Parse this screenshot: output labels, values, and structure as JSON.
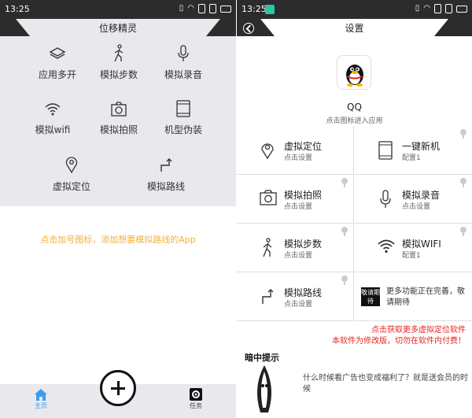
{
  "left": {
    "status_time": "13:25",
    "title": "位移精灵",
    "items": [
      {
        "label": "应用多开",
        "icon": "layers-icon"
      },
      {
        "label": "模拟步数",
        "icon": "walking-person-icon"
      },
      {
        "label": "模拟录音",
        "icon": "microphone-icon"
      },
      {
        "label": "模拟wifi",
        "icon": "wifi-icon"
      },
      {
        "label": "模拟拍照",
        "icon": "camera-icon"
      },
      {
        "label": "机型伪装",
        "icon": "phone-device-icon"
      },
      {
        "label": "虚拟定位",
        "icon": "location-pin-icon"
      },
      {
        "label": "模拟路线",
        "icon": "route-arrow-icon"
      }
    ],
    "hint": "点击加号图标，添加想要模拟路线的App",
    "bottom": {
      "home_label": "主页",
      "task_label": "任务"
    }
  },
  "right": {
    "status_time": "13:25",
    "title": "设置",
    "app_name": "QQ",
    "app_hint": "点击图标进入应用",
    "cells": [
      {
        "title": "虚拟定位",
        "sub": "点击设置",
        "icon": "location-pin-icon"
      },
      {
        "title": "一键新机",
        "sub": "配置1",
        "icon": "phone-device-icon"
      },
      {
        "title": "模拟拍照",
        "sub": "点击设置",
        "icon": "camera-icon"
      },
      {
        "title": "模拟录音",
        "sub": "点击设置",
        "icon": "microphone-icon"
      },
      {
        "title": "模拟步数",
        "sub": "点击设置",
        "icon": "walking-person-icon"
      },
      {
        "title": "模拟WIFI",
        "sub": "配置1",
        "icon": "wifi-icon"
      },
      {
        "title": "模拟路线",
        "sub": "点击设置",
        "icon": "route-arrow-icon"
      }
    ],
    "more_badge": "敬请期待",
    "more_text": "更多功能正在完善，敬请期待",
    "ad_line1": "点击获取更多虚拟定位软件",
    "ad_line2": "本软件为修改版，切勿在软件内付费！",
    "ad_logo_text": "暗中提示",
    "ad_body": "什么时候看广告也变成福利了？就是送会员的时候"
  },
  "colors": {
    "accent_yellow": "#f2b13a",
    "warning_red": "#e8261c",
    "home_blue": "#3a9ef0",
    "qq_badge_teal": "#2fc3a7"
  }
}
